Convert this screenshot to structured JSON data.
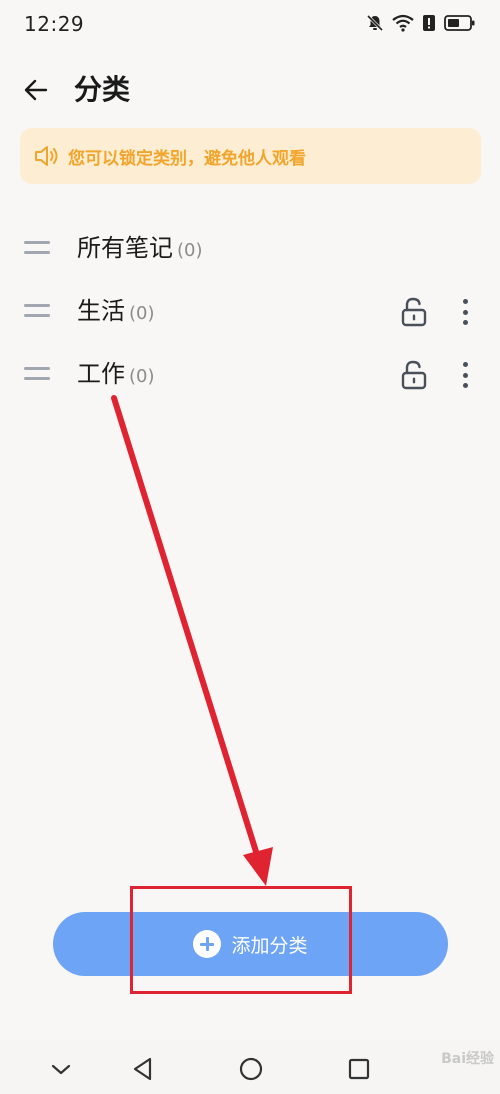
{
  "status_bar": {
    "time": "12:29",
    "icons": [
      "bell-off-icon",
      "wifi-icon",
      "alert-icon",
      "battery-icon"
    ]
  },
  "header": {
    "back_icon": "back-arrow-icon",
    "title": "分类"
  },
  "notice": {
    "icon": "speaker-icon",
    "text": "您可以锁定类别，避免他人观看",
    "color": "#f2a52c",
    "background": "#fdeed3"
  },
  "categories": [
    {
      "name": "所有笔记",
      "count": "(0)",
      "lockable": false
    },
    {
      "name": "生活",
      "count": "(0)",
      "lockable": true
    },
    {
      "name": "工作",
      "count": "(0)",
      "lockable": true
    }
  ],
  "add_button": {
    "label": "添加分类",
    "icon": "plus-circle-icon",
    "color": "#6ea4f5"
  },
  "nav_bar": {
    "buttons": [
      "chevron-down-icon",
      "back-triangle-icon",
      "home-circle-icon",
      "recents-square-icon"
    ]
  },
  "watermark": "Bai经验",
  "annotation_color": "#e02330"
}
